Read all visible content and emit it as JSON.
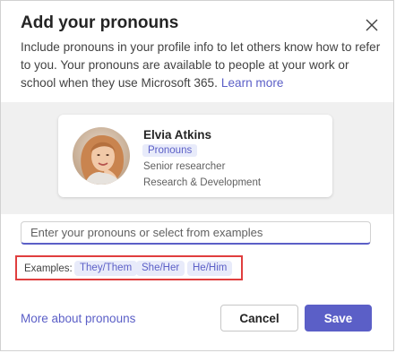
{
  "dialog": {
    "title": "Add your pronouns",
    "description": "Include pronouns in your profile info to let others know how to refer to you. Your pronouns are available to people at your work or school when they use Microsoft 365.",
    "learn_more": "Learn more",
    "close_icon": "close-icon"
  },
  "profile_card": {
    "name": "Elvia Atkins",
    "pronouns_badge": "Pronouns",
    "role": "Senior researcher",
    "department": "Research & Development"
  },
  "pronoun_input": {
    "placeholder": "Enter your pronouns or select from examples",
    "value": ""
  },
  "examples": {
    "label": "Examples:",
    "options": [
      "They/Them",
      "She/Her",
      "He/Him"
    ]
  },
  "footer": {
    "more_link": "More about pronouns",
    "cancel": "Cancel",
    "save": "Save"
  },
  "colors": {
    "accent": "#5b5fc7",
    "chip_bg": "#e8ebfa",
    "highlight_border": "#e03e3e",
    "band_bg": "#f0f0f0"
  }
}
